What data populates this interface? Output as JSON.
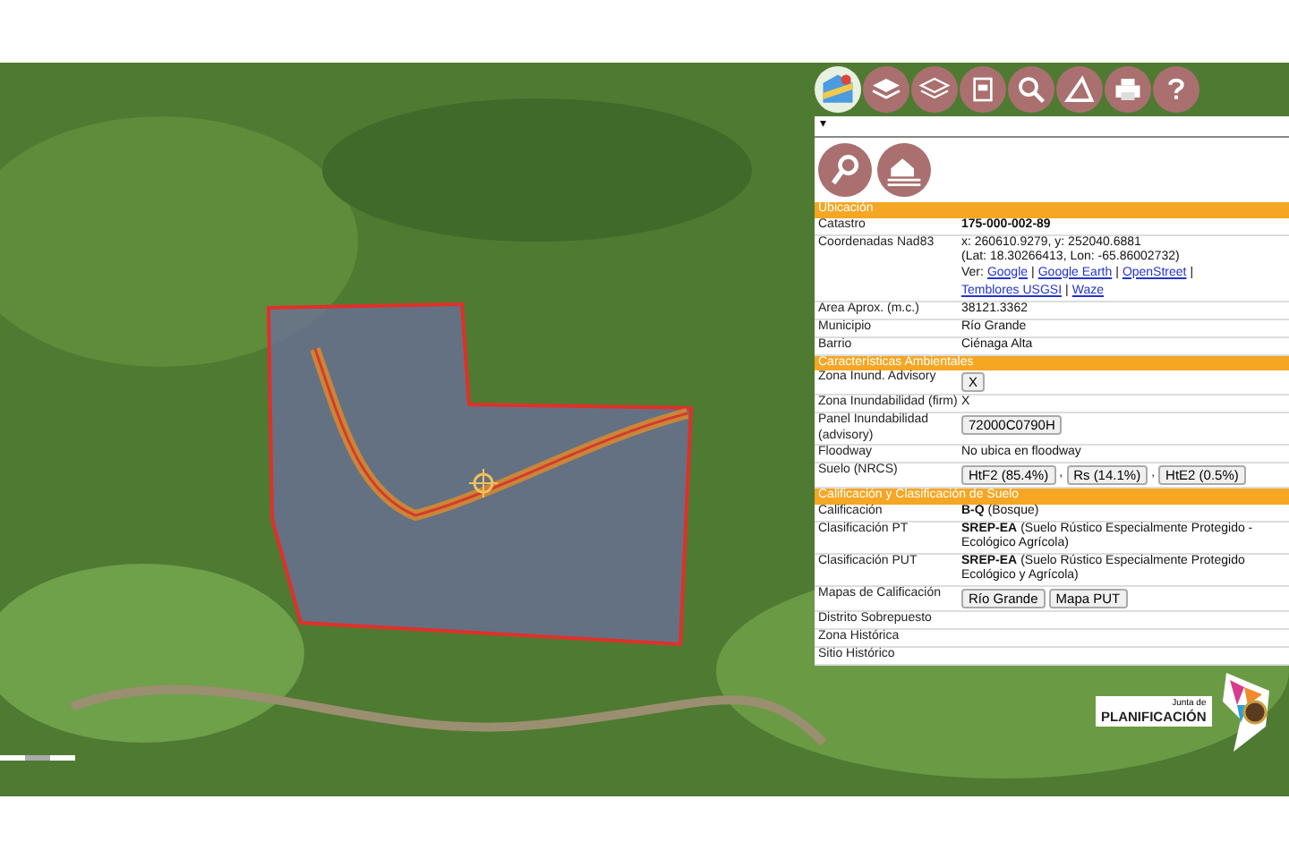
{
  "toolbar": {
    "tools": [
      {
        "kind": "maps"
      },
      {
        "kind": "layers"
      },
      {
        "kind": "layers-outline"
      },
      {
        "kind": "document"
      },
      {
        "kind": "search"
      },
      {
        "kind": "measure"
      },
      {
        "kind": "print"
      },
      {
        "kind": "help"
      }
    ]
  },
  "panel": {
    "toggle": "▾",
    "actions": [
      {
        "kind": "swap"
      },
      {
        "kind": "flood-house"
      }
    ],
    "sections": [
      {
        "title": "Ubicación",
        "rows": [
          {
            "kind": "text",
            "label": "Catastro",
            "value": "**175-000-002-89**"
          },
          {
            "kind": "coords",
            "label": "Coordenadas Nad83",
            "lines": [
              "x: 260610.9279, y: 252040.6881",
              "(Lat: 18.30266413, Lon: -65.86002732)"
            ],
            "prefix": "Ver:",
            "separator": "|",
            "links": [
              "Google",
              "Google Earth",
              "OpenStreet",
              "Temblores USGSI",
              "Waze"
            ]
          },
          {
            "kind": "text",
            "label": "Area Aprox. (m.c.)",
            "value": "38121.3362"
          },
          {
            "kind": "text",
            "label": "Municipio",
            "value": "Río Grande"
          },
          {
            "kind": "text",
            "label": "Barrio",
            "value": "Ciénaga Alta"
          }
        ]
      },
      {
        "title": "Características Ambientales",
        "rows": [
          {
            "kind": "buttons",
            "label": "Zona Inund. Advisory",
            "separator": "",
            "buttons": [
              "X"
            ]
          },
          {
            "kind": "text",
            "label": "Zona Inundabilidad (firm)",
            "value": "X"
          },
          {
            "kind": "buttons",
            "label": "Panel Inundabilidad (advisory)",
            "separator": "",
            "buttons": [
              "72000C0790H"
            ]
          },
          {
            "kind": "text",
            "label": "Floodway",
            "value": "No ubica en floodway"
          },
          {
            "kind": "buttons",
            "label": "Suelo (NRCS)",
            "separator": ",",
            "buttons": [
              "HtF2 (85.4%)",
              "Rs (14.1%)",
              "HtE2 (0.5%)"
            ]
          }
        ]
      },
      {
        "title": "Calificación y Clasificación de Suelo",
        "rows": [
          {
            "kind": "text",
            "label": "Calificación",
            "value": "**B-Q** (Bosque)"
          },
          {
            "kind": "text",
            "label": "Clasificación PT",
            "value": "**SREP-EA** (Suelo Rústico Especialmente Protegido - Ecológico Agrícola)"
          },
          {
            "kind": "text",
            "label": "Clasificación PUT",
            "value": "**SREP-EA** (Suelo Rústico Especialmente Protegido Ecológico y Agrícola)"
          },
          {
            "kind": "buttons",
            "label": "Mapas de Calificación",
            "separator": "",
            "buttons": [
              "Río Grande",
              "Mapa PUT"
            ]
          },
          {
            "kind": "text",
            "label": "Distrito Sobrepuesto"
          },
          {
            "kind": "text",
            "label": "Zona Histórica"
          },
          {
            "kind": "text",
            "label": "Sitio Histórico"
          }
        ]
      }
    ]
  },
  "logo": {
    "small": "Junta de",
    "big": "PLANIFICACIÓN"
  }
}
